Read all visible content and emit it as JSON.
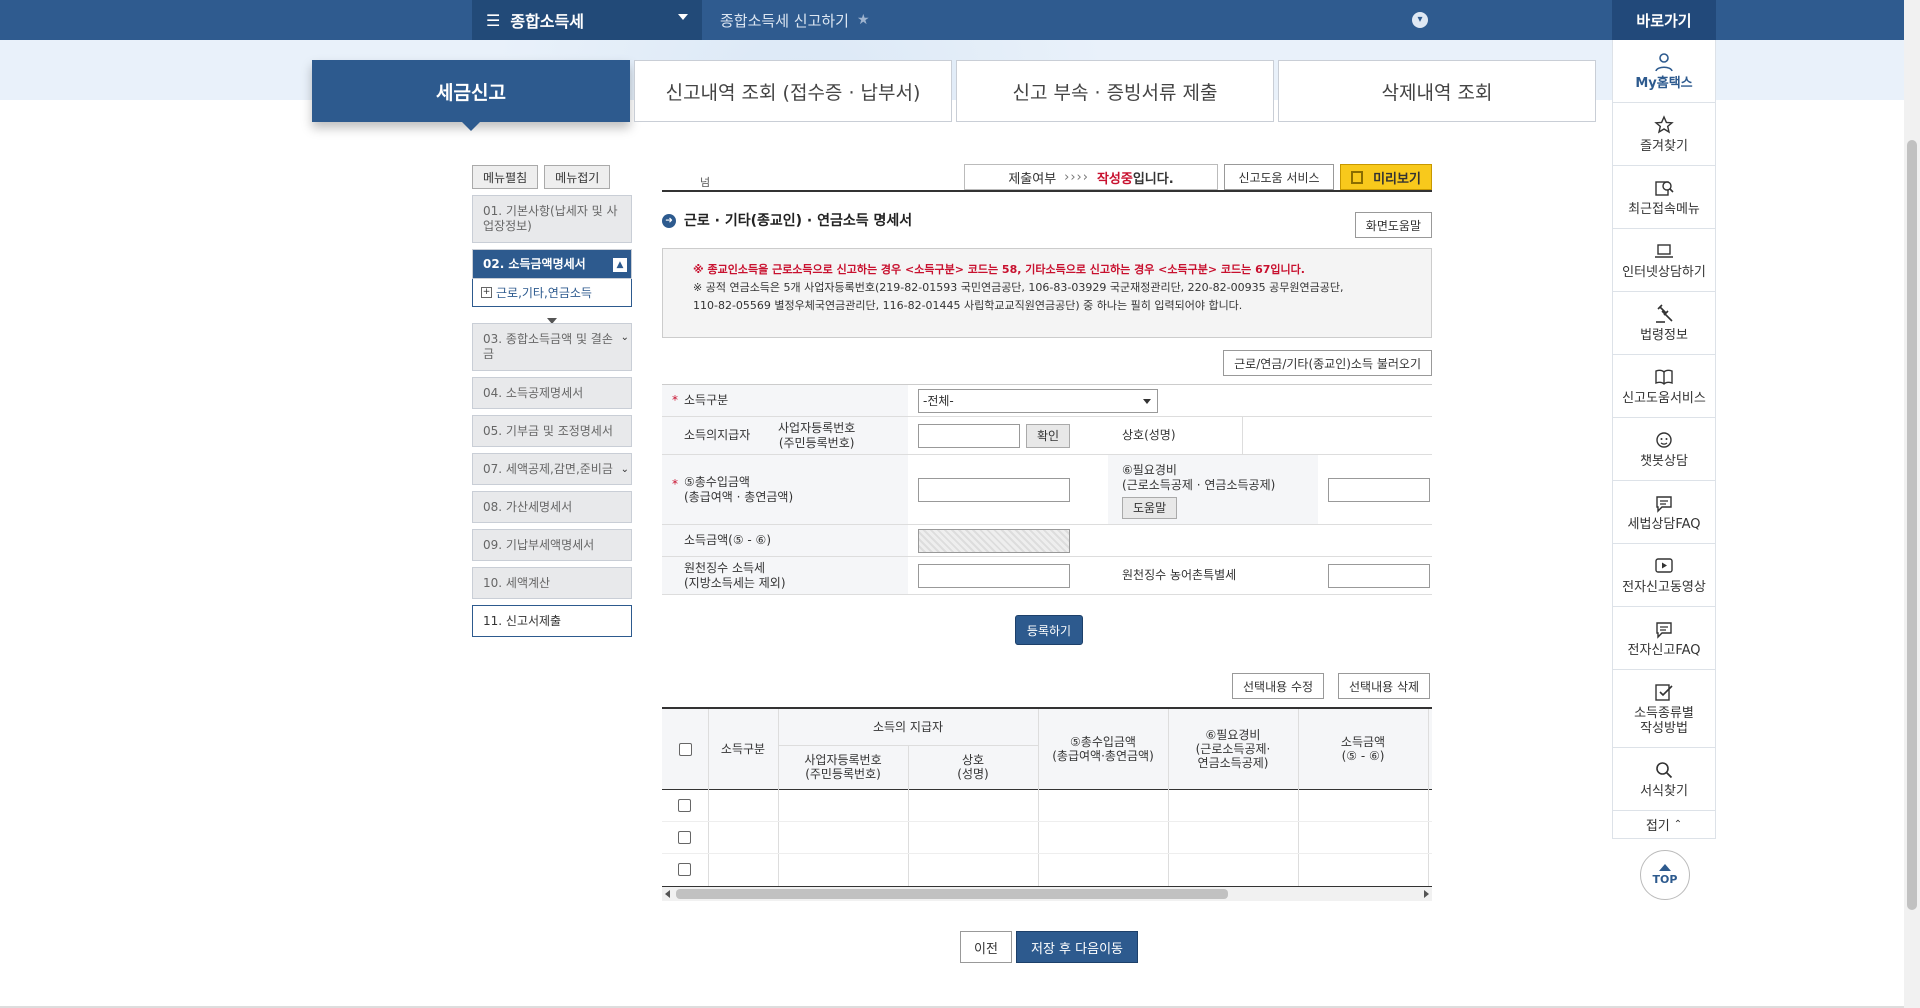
{
  "header": {
    "menu_label": "종합소득세",
    "breadcrumb": "종합소득세 신고하기"
  },
  "tabs": [
    {
      "label": "세금신고",
      "active": true
    },
    {
      "label": "신고내역 조회 (접수증 · 납부서)",
      "active": false
    },
    {
      "label": "신고 부속 · 증빙서류 제출",
      "active": false
    },
    {
      "label": "삭제내역 조회",
      "active": false
    }
  ],
  "quick_menu": {
    "title": "바로가기",
    "items": [
      {
        "label": "My홈택스",
        "icon": "person-icon"
      },
      {
        "label": "즐겨찾기",
        "icon": "star-icon"
      },
      {
        "label": "최근접속메뉴",
        "icon": "recent-icon"
      },
      {
        "label": "인터넷상담하기",
        "icon": "laptop-icon"
      },
      {
        "label": "법령정보",
        "icon": "gavel-icon"
      },
      {
        "label": "신고도움서비스",
        "icon": "book-icon"
      },
      {
        "label": "챗봇상담",
        "icon": "chatbot-icon"
      },
      {
        "label": "세법상담FAQ",
        "icon": "chat-icon"
      },
      {
        "label": "전자신고동영상",
        "icon": "play-icon"
      },
      {
        "label": "전자신고FAQ",
        "icon": "chat-icon"
      },
      {
        "label": "소득종류별\n작성방법",
        "icon": "edit-icon"
      },
      {
        "label": "서식찾기",
        "icon": "search-icon"
      }
    ],
    "fold_label": "접기",
    "top_label": "TOP"
  },
  "sidebar": {
    "edit_label": "메뉴펼침",
    "fold_label": "메뉴접기",
    "items": [
      {
        "label": "01. 기본사항(납세자 및 사업장정보)"
      },
      {
        "label": "02. 소득금액명세서",
        "active": true
      },
      {
        "label": "03. 종합소득금액 및 결손금"
      },
      {
        "label": "04. 소득공제명세서"
      },
      {
        "label": "05. 기부금 및 조정명세서"
      },
      {
        "label": "07. 세액공제,감면,준비금"
      },
      {
        "label": "08. 가산세명세서"
      },
      {
        "label": "09. 기납부세액명세서"
      },
      {
        "label": "10. 세액계산"
      },
      {
        "label": "11. 신고서제출"
      }
    ],
    "sub_item": "근로,기타,연금소득"
  },
  "status": {
    "indicator": "넘",
    "label": "제출여부",
    "arrows": "››››",
    "state": "작성중",
    "state_suffix": "입니다.",
    "help_service": "신고도움 서비스",
    "preview": "미리보기"
  },
  "section": {
    "title": "근로 · 기타(종교인) · 연금소득 명세서",
    "screen_help": "화면도움말",
    "notice_red": "※ 종교인소득을 근로소득으로 신고하는 경우 <소득구분> 코드는 58, 기타소득으로 신고하는 경우 <소득구분> 코드는 67입니다.",
    "notice_1": "※ 공적 연금소득은 5개 사업자등록번호(219-82-01593 국민연금공단, 106-83-03929 국군재정관리단, 220-82-00935 공무원연금공단,",
    "notice_2": "110-82-05569 별정우체국연금관리단, 116-82-01445 사립학교교직원연금공단) 중 하나는 필히 입력되어야 합니다.",
    "load_button": "근로/연금/기타(종교인)소득 불러오기"
  },
  "form": {
    "income_type_label": "소득구분",
    "income_type_value": "-전체-",
    "payer_label": "소득의지급자",
    "bizno_label": "사업자등록번호\n(주민등록번호)",
    "confirm_btn": "확인",
    "name_label": "상호(성명)",
    "gross_label": "⑤총수입금액\n(총급여액 · 총연금액)",
    "expense_label": "⑥필요경비\n(근로소득공제 · 연금소득공제)",
    "expense_help": "도움말",
    "income_amount_label": "소득금액(⑤ - ⑥)",
    "withhold_tax_label": "원천징수 소득세\n(지방소득세는 제외)",
    "withhold_rural_label": "원천징수 농어촌특별세",
    "register_btn": "등록하기"
  },
  "table_actions": {
    "edit": "선택내용 수정",
    "delete": "선택내용 삭제"
  },
  "table": {
    "headers": {
      "type": "소득구분",
      "payer_group": "소득의 지급자",
      "bizno": "사업자등록번호\n(주민등록번호)",
      "name": "상호\n(성명)",
      "gross": "⑤총수입금액\n(총급여액·총연금액)",
      "expense": "⑥필요경비\n(근로소득공제·\n연금소득공제)",
      "income": "소득금액\n(⑤ - ⑥)"
    },
    "row_count": 3
  },
  "nav": {
    "prev": "이전",
    "next": "저장 후 다음이동"
  },
  "colors": {
    "primary": "#2d5a8e",
    "topbar": "#2f5b8f",
    "red": "#c8102e",
    "preview_yellow": "#f8c91c"
  }
}
